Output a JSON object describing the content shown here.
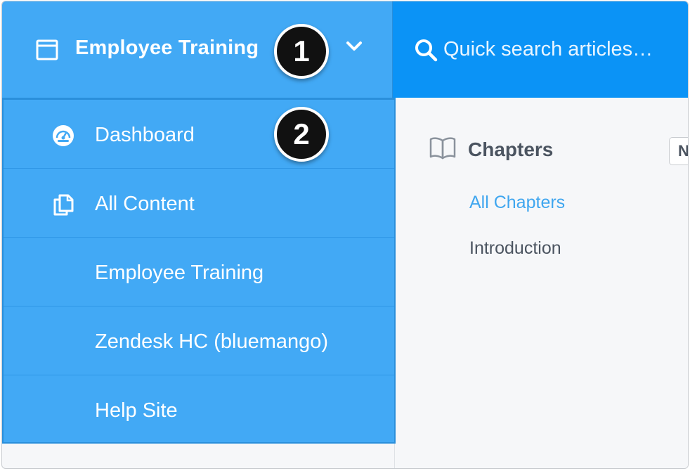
{
  "header": {
    "site_title": "Employee Training",
    "site_icon": "window-icon",
    "dropdown_icon": "chevron-down-icon"
  },
  "search": {
    "placeholder": "Quick search articles…",
    "icon": "search-icon"
  },
  "menu": {
    "items": [
      {
        "label": "Dashboard",
        "icon": "dashboard-gauge-icon"
      },
      {
        "label": "All Content",
        "icon": "documents-icon"
      },
      {
        "label": "Employee Training",
        "icon": ""
      },
      {
        "label": "Zendesk HC (bluemango)",
        "icon": ""
      },
      {
        "label": "Help Site",
        "icon": ""
      }
    ]
  },
  "content": {
    "heading": "Chapters",
    "heading_icon": "book-icon",
    "new_button_label": "N",
    "chapters": [
      {
        "label": "All Chapters",
        "active": true
      },
      {
        "label": "Introduction",
        "active": false
      }
    ]
  },
  "callouts": [
    "1",
    "2"
  ],
  "colors": {
    "menu_blue": "#42a9f5",
    "search_blue": "#0b93f6",
    "link_blue": "#3fa6ef",
    "text_gray": "#4b5460"
  }
}
